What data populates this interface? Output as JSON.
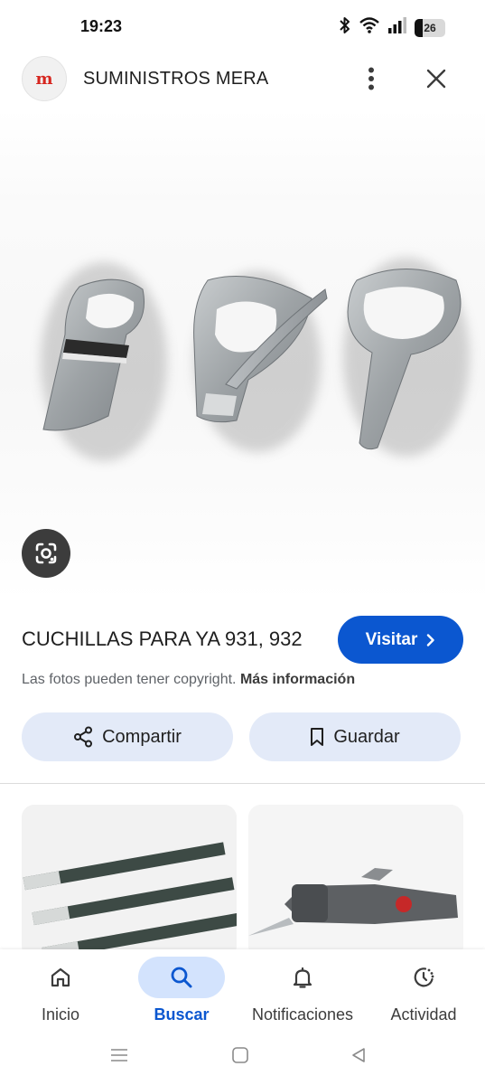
{
  "status_bar": {
    "time": "19:23",
    "battery": "26",
    "icons": [
      "bluetooth-icon",
      "wifi-icon",
      "signal-icon",
      "battery-icon"
    ]
  },
  "header": {
    "site_name": "SUMINISTROS MERA",
    "logo_letter": "m"
  },
  "result": {
    "title": "CUCHILLAS PARA YA 931, 932",
    "visit_label": "Visitar",
    "copyright_text": "Las fotos pueden tener copyright.",
    "more_info": "Más información"
  },
  "actions": {
    "share_label": "Compartir",
    "save_label": "Guardar"
  },
  "bottom_nav": [
    {
      "label": "Inicio",
      "icon": "home-icon",
      "active": false
    },
    {
      "label": "Buscar",
      "icon": "search-icon",
      "active": true
    },
    {
      "label": "Notificaciones",
      "icon": "bell-icon",
      "active": false
    },
    {
      "label": "Actividad",
      "icon": "activity-icon",
      "active": false
    }
  ],
  "colors": {
    "accent": "#0b57d0",
    "chip_bg": "#e3eaf8",
    "active_nav_bg": "#d3e3fd",
    "logo_red": "#d6261f"
  }
}
